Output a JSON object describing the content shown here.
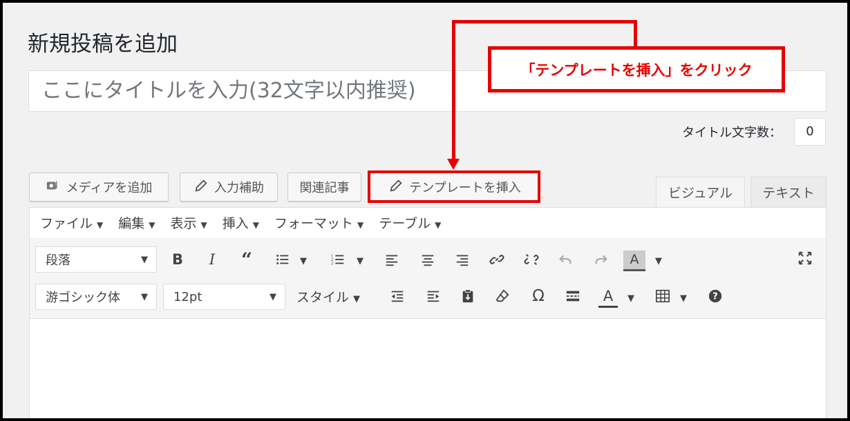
{
  "page": {
    "title": "新規投稿を追加"
  },
  "title_input": {
    "placeholder": "ここにタイトルを入力(32文字以内推奨)"
  },
  "title_count": {
    "label": "タイトル文字数：",
    "value": "0"
  },
  "buttons": {
    "add_media": "メディアを追加",
    "input_assist": "入力補助",
    "related_articles": "関連記事",
    "insert_template": "テンプレートを挿入"
  },
  "tabs": {
    "visual": "ビジュアル",
    "text": "テキスト"
  },
  "menubar": [
    "ファイル",
    "編集",
    "表示",
    "挿入",
    "フォーマット",
    "テーブル"
  ],
  "selects": {
    "paragraph": "段落",
    "font": "游ゴシック体",
    "size": "12pt"
  },
  "toolbar_labels": {
    "style": "スタイル"
  },
  "callout": {
    "text": "「テンプレートを挿入」をクリック"
  },
  "colors": {
    "accent": "#e60000",
    "background": "#f1f1f1"
  },
  "icons": [
    "media-icon",
    "pencil-icon",
    "bold-icon",
    "italic-icon",
    "blockquote-icon",
    "bullet-list-icon",
    "numbered-list-icon",
    "align-left-icon",
    "align-center-icon",
    "align-right-icon",
    "link-icon",
    "unlink-icon",
    "undo-icon",
    "redo-icon",
    "text-color-icon",
    "fullscreen-icon",
    "outdent-icon",
    "indent-icon",
    "paste-icon",
    "eraser-icon",
    "omega-icon",
    "more-icon",
    "table-icon",
    "help-icon"
  ]
}
